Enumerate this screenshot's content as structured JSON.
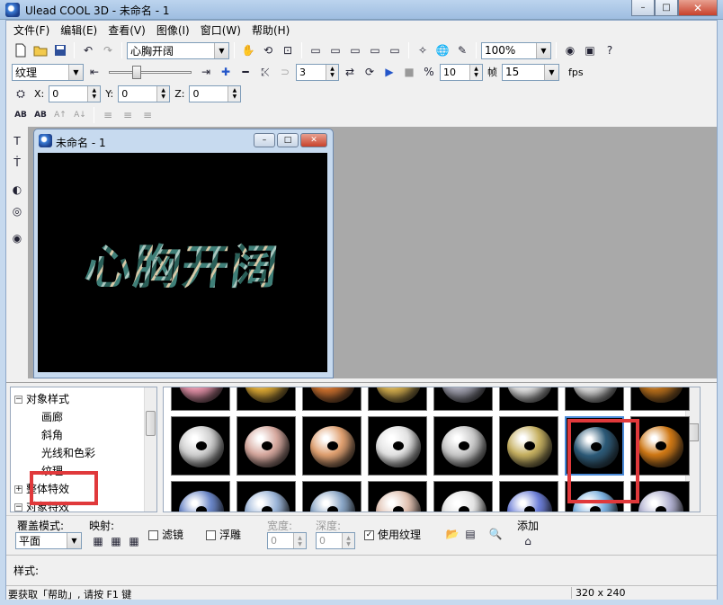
{
  "window": {
    "title": "Ulead COOL 3D - 未命名 - 1",
    "btn_min": "–",
    "btn_max": "□",
    "btn_close": "✕"
  },
  "menu": [
    "文件(F)",
    "编辑(E)",
    "查看(V)",
    "图像(I)",
    "窗口(W)",
    "帮助(H)"
  ],
  "toolbar1": {
    "text_combo": "心胸开阔",
    "zoom_combo": "100%"
  },
  "toolbar2": {
    "attr_combo": "纹理",
    "frame_num": "3",
    "total_frames": "10",
    "frame_label": "帧",
    "fps_value": "15",
    "fps_label": "fps"
  },
  "toolbar3": {
    "x_label": "X:",
    "x_value": "0",
    "y_label": "Y:",
    "y_value": "0",
    "z_label": "Z:",
    "z_value": "0"
  },
  "document": {
    "title": "未命名 - 1",
    "canvas_text": "心胸开阔",
    "btn_min": "–",
    "btn_max": "□",
    "btn_close": "✕"
  },
  "tree": {
    "object_style": "对象样式",
    "gallery": "画廊",
    "bevel": "斜角",
    "light_color": "光线和色彩",
    "texture": "纹理",
    "effects_partial": "整体特效",
    "object_effects": "对象特效"
  },
  "options": {
    "cover_mode_label": "覆盖模式:",
    "cover_mode_value": "平面",
    "mapping_label": "映射:",
    "filter_label": "滤镜",
    "emboss_label": "浮雕",
    "width_label": "宽度:",
    "width_value": "0",
    "depth_label": "深度:",
    "depth_value": "0",
    "use_texture_label": "使用纹理",
    "add_label": "添加"
  },
  "style_label": "样式:",
  "status": {
    "help_text": "要获取「帮助」, 请按 F1 键",
    "size": "320 x 240"
  },
  "gallery_colors": {
    "row1": [
      "#d98aa0",
      "#d2a030",
      "#c26a2a",
      "#c9a448",
      "#9a9aa8",
      "#d7d7d7",
      "#d0d0d0",
      "#b26a18"
    ],
    "row2": [
      "#cfcfcf",
      "#d6a89e",
      "#e0a070",
      "#e2e2e2",
      "#c8c8c8",
      "#c6b060",
      "#2c5a78",
      "#d07814"
    ],
    "row3": [
      "#6a86c8",
      "#9ab4d8",
      "#8aa6c6",
      "#e0c0b0",
      "#e4e4e4",
      "#6c7ed8",
      "#7ab0e0",
      "#b0b0d0"
    ]
  },
  "highlight_color": "#e0393b"
}
